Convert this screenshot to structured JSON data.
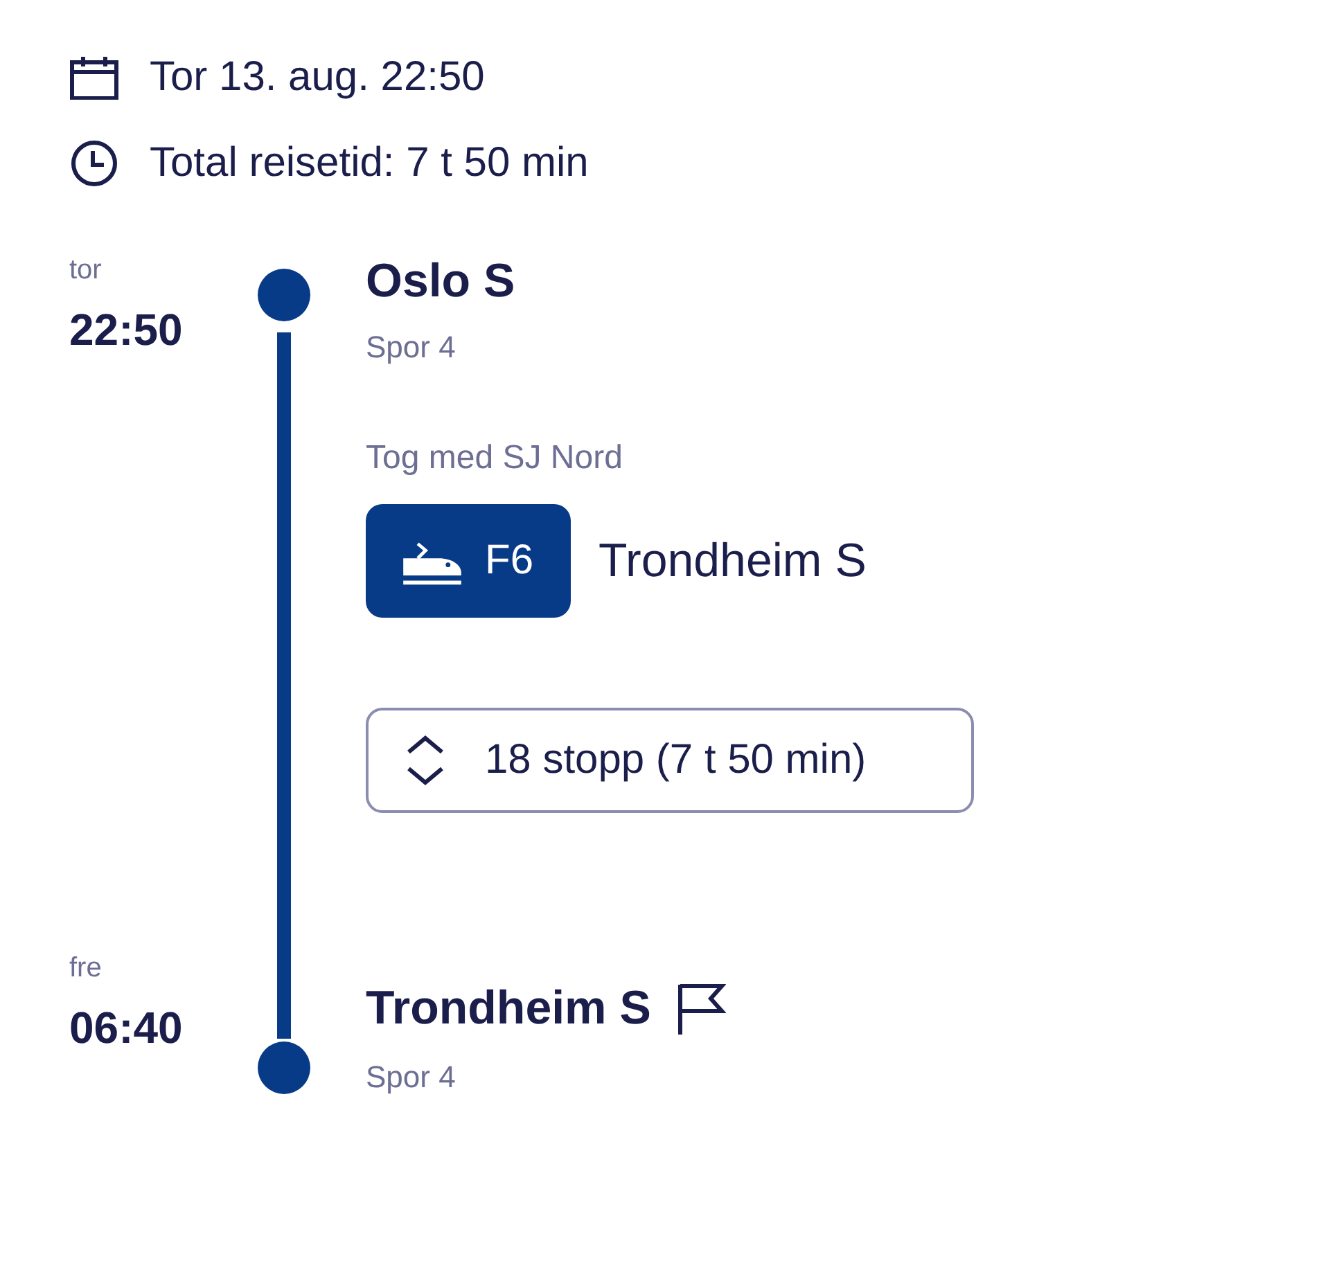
{
  "trip_summary": [
    {
      "kind": "date",
      "text": "Tor 13. aug. 22:50"
    },
    {
      "kind": "duration",
      "text": "Total reisetid: 7 t 50 min"
    }
  ],
  "departure": {
    "day": "tor",
    "time": "22:50",
    "station": "Oslo S",
    "track": "Spor 4"
  },
  "leg": {
    "operator": "Tog med SJ Nord",
    "line": "F6",
    "destination": "Trondheim S",
    "stops_button": {
      "label": "18 stopp (7 t 50 min)"
    }
  },
  "arrival": {
    "day": "fre",
    "time": "06:40",
    "station": "Trondheim S",
    "track": "Spor 4",
    "flag": true
  }
}
